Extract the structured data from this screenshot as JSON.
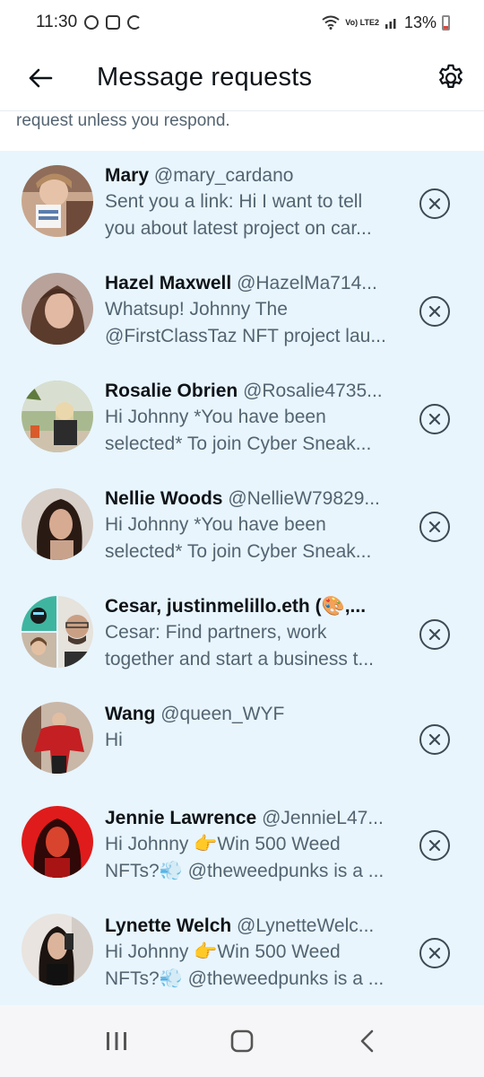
{
  "status_bar": {
    "time": "11:30",
    "left_icons": [
      "whatsapp-icon",
      "instagram-icon",
      "sync-icon"
    ],
    "network": "Vo) LTE2",
    "battery": "13%"
  },
  "header": {
    "title": "Message requests"
  },
  "notice": {
    "text": "request unless you respond."
  },
  "requests": [
    {
      "name": "Mary",
      "handle": "@mary_cardano",
      "line1": "Sent you a link: Hi I want to tell",
      "line2": "you about latest project on car..."
    },
    {
      "name": "Hazel Maxwell",
      "handle": "@HazelMa714...",
      "line1": "Whatsup! Johnny The",
      "line2": "@FirstClassTaz NFT project lau..."
    },
    {
      "name": "Rosalie Obrien",
      "handle": "@Rosalie4735...",
      "line1": "Hi Johnny *You have been",
      "line2": "selected*  To join Cyber Sneak..."
    },
    {
      "name": "Nellie Woods",
      "handle": "@NellieW79829...",
      "line1": "Hi Johnny *You have been",
      "line2": "selected*  To join Cyber Sneak..."
    },
    {
      "name": "Cesar, justinmelillo.eth (🎨,...",
      "handle": "",
      "line1": "Cesar: Find partners, work",
      "line2": "together and start a business t..."
    },
    {
      "name": "Wang",
      "handle": "@queen_WYF",
      "line1": "Hi",
      "line2": ""
    },
    {
      "name": "Jennie Lawrence",
      "handle": "@JennieL47...",
      "line1": "Hi Johnny 👉Win 500 Weed",
      "line2": "NFTs?💨 @theweedpunks is a ..."
    },
    {
      "name": "Lynette Welch",
      "handle": "@LynetteWelc...",
      "line1": "Hi Johnny 👉Win 500 Weed",
      "line2": "NFTs?💨 @theweedpunks is a ..."
    }
  ],
  "nav": [
    "recents-icon",
    "home-icon",
    "back-icon"
  ],
  "colors": {
    "list_bg": "#e8f5fd",
    "primary_text": "#0f1419",
    "secondary_text": "#536471"
  }
}
